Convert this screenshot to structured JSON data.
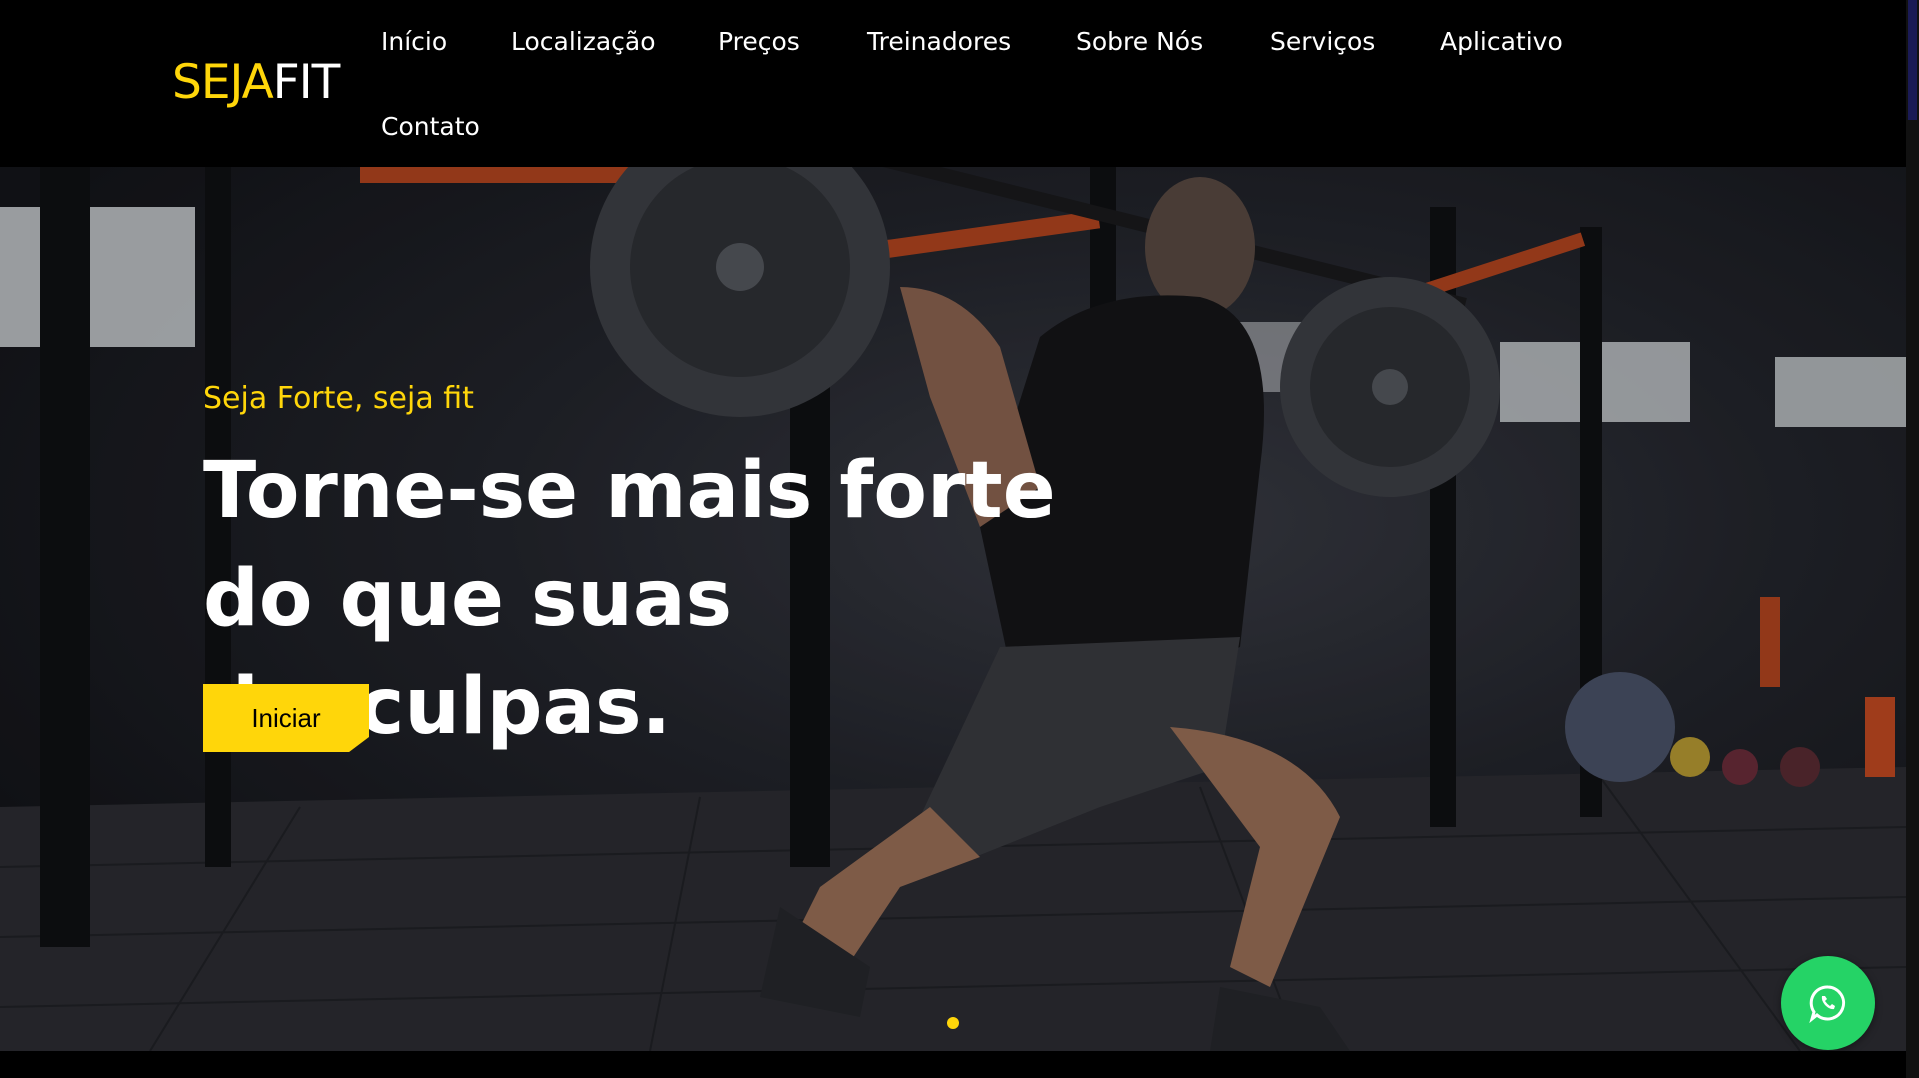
{
  "brand": {
    "part1": "SEJA",
    "part2": "FIT",
    "accent": "#ffd60a"
  },
  "nav": {
    "items": [
      {
        "label": "Início"
      },
      {
        "label": "Localização"
      },
      {
        "label": "Preços"
      },
      {
        "label": "Treinadores"
      },
      {
        "label": "Sobre Nós"
      },
      {
        "label": "Serviços"
      },
      {
        "label": "Aplicativo"
      },
      {
        "label": "Contato"
      }
    ]
  },
  "hero": {
    "subtitle": "Seja Forte, seja fit",
    "headline": "Torne-se mais forte do que suas desculpas.",
    "cta_label": "Iniciar",
    "image": "gym-athlete-barbell-lunge-photo"
  },
  "floating": {
    "icon": "whatsapp-icon",
    "color": "#25d366"
  },
  "carousel": {
    "active_dot_color": "#ffd60a"
  }
}
